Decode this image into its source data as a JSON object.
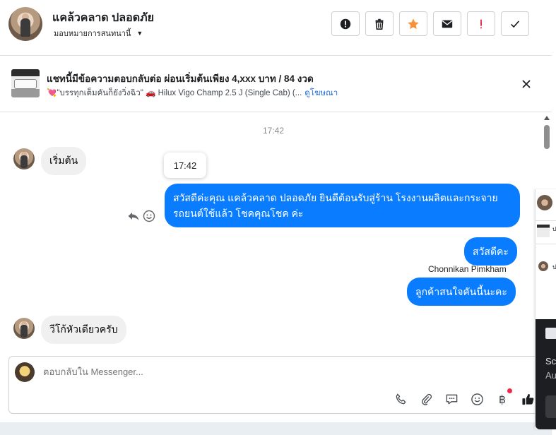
{
  "header": {
    "name": "แคล้วคลาด ปลอดภัย",
    "assign_label": "มอบหมายการสนทนานี้",
    "actions": [
      {
        "icon": "exclamation-circle-icon",
        "color": "#1c1e21"
      },
      {
        "icon": "trash-icon",
        "color": "#1c1e21"
      },
      {
        "icon": "star-icon",
        "color": "#f7923b"
      },
      {
        "icon": "envelope-icon",
        "color": "#1c1e21"
      },
      {
        "icon": "exclamation-icon",
        "color": "#e41e3f"
      },
      {
        "icon": "check-icon",
        "color": "#1c1e21"
      }
    ]
  },
  "banner": {
    "title": "แชทนี้มีข้อความตอบกลับต่อ ผ่อนเริ่มต้นเพียง 4,xxx บาท / 84 งวด",
    "subtitle": "💘\"บรรทุกเต็มคันก็ยังวิ่งฉิว\" 🚗 Hilux Vigo Champ 2.5 J (Single Cab) (...",
    "link": "ดูโฆษณา"
  },
  "chat": {
    "timestamp": "17:42",
    "tooltip_time": "17:42",
    "messages": [
      {
        "side": "in",
        "text": "เริ่มต้น"
      },
      {
        "side": "out",
        "text": "สวัสดีค่ะคุณ แคล้วคลาด ปลอดภัย ยินดีต้อนรับสู่ร้าน โรงงานผลิตและกระจายรถยนต์ใช้แล้ว โชคคุณโชค ค่ะ"
      },
      {
        "side": "out",
        "text": "สวัสดีคะ"
      },
      {
        "side": "out",
        "text": "ลูกค้าสนใจคันนี้นะคะ"
      },
      {
        "side": "in",
        "text": "วีโก้หัวเดียวครับ"
      }
    ],
    "sender_name": "Chonnikan Pimkham"
  },
  "composer": {
    "placeholder": "ตอบกลับใน Messenger...",
    "tools": [
      "phone-icon",
      "paperclip-icon",
      "chat-bubble-icon",
      "smiley-icon",
      "baht-icon",
      "thumbs-up-icon"
    ]
  },
  "overlay": {
    "line1": "Sc",
    "line2": "Au",
    "tiny1": "ป",
    "tiny2": "ป"
  },
  "colors": {
    "accent": "#0a7cff",
    "incoming_bubble": "#f0f0f0",
    "link": "#216fdb"
  }
}
